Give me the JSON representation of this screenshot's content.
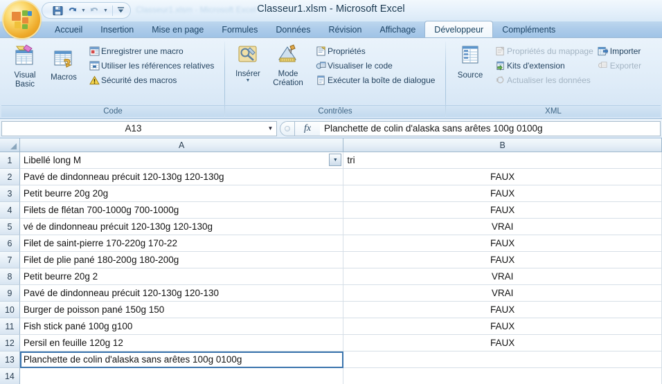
{
  "window": {
    "title": "Classeur1.xlsm - Microsoft Excel",
    "ghost_title": "Classeur1.xlsm - Microsoft Excel"
  },
  "quick_access": {
    "save_label": "save-icon",
    "undo_label": "undo-icon",
    "redo_label": "redo-icon",
    "customize_label": "customize-icon"
  },
  "tabs": [
    {
      "label": "Accueil",
      "active": false
    },
    {
      "label": "Insertion",
      "active": false
    },
    {
      "label": "Mise en page",
      "active": false
    },
    {
      "label": "Formules",
      "active": false
    },
    {
      "label": "Données",
      "active": false
    },
    {
      "label": "Révision",
      "active": false
    },
    {
      "label": "Affichage",
      "active": false
    },
    {
      "label": "Développeur",
      "active": true
    },
    {
      "label": "Compléments",
      "active": false
    }
  ],
  "ribbon": {
    "groups": [
      {
        "name": "Code",
        "label": "Code",
        "big_buttons": [
          {
            "label_line1": "Visual",
            "label_line2": "Basic",
            "icon": "visual-basic-icon"
          },
          {
            "label_line1": "Macros",
            "label_line2": "",
            "icon": "macros-icon"
          }
        ],
        "small_buttons": [
          {
            "label": "Enregistrer une macro",
            "icon": "record-macro-icon",
            "disabled": false
          },
          {
            "label": "Utiliser les références relatives",
            "icon": "relative-references-icon",
            "disabled": false
          },
          {
            "label": "Sécurité des macros",
            "icon": "warning-icon",
            "disabled": false
          }
        ]
      },
      {
        "name": "Controles",
        "label": "Contrôles",
        "big_buttons": [
          {
            "label_line1": "Insérer",
            "label_line2": "",
            "icon": "insert-control-icon",
            "has_caret": true
          },
          {
            "label_line1": "Mode",
            "label_line2": "Création",
            "icon": "design-mode-icon"
          }
        ],
        "small_buttons": [
          {
            "label": "Propriétés",
            "icon": "properties-icon",
            "disabled": false
          },
          {
            "label": "Visualiser le code",
            "icon": "view-code-icon",
            "disabled": false
          },
          {
            "label": "Exécuter la boîte de dialogue",
            "icon": "run-dialog-icon",
            "disabled": false
          }
        ]
      },
      {
        "name": "XML",
        "label": "XML",
        "big_buttons": [
          {
            "label_line1": "Source",
            "label_line2": "",
            "icon": "xml-source-icon"
          }
        ],
        "small_buttons": [
          {
            "label": "Propriétés du mappage",
            "icon": "map-properties-icon",
            "disabled": true
          },
          {
            "label": "Kits d'extension",
            "icon": "expansion-packs-icon",
            "disabled": false
          },
          {
            "label": "Actualiser les données",
            "icon": "refresh-data-icon",
            "disabled": true
          }
        ],
        "small_buttons_2": [
          {
            "label": "Importer",
            "icon": "import-icon",
            "disabled": false
          },
          {
            "label": "Exporter",
            "icon": "export-icon",
            "disabled": true
          }
        ]
      }
    ]
  },
  "formula_bar": {
    "name_box_value": "A13",
    "fx_label": "fx",
    "formula_value": "Planchette de colin d'alaska sans arêtes 100g 0100g"
  },
  "sheet": {
    "columns": [
      {
        "letter": "A"
      },
      {
        "letter": "B"
      }
    ],
    "rows": [
      {
        "num": "1",
        "a": "Libellé long M",
        "b": "tri",
        "has_filter": true,
        "b_align": "left"
      },
      {
        "num": "2",
        "a": "Pavé de dindonneau précuit 120-130g 120-130g",
        "b": "FAUX"
      },
      {
        "num": "3",
        "a": "Petit beurre 20g 20g",
        "b": "FAUX"
      },
      {
        "num": "4",
        "a": "Filets de flétan 700-1000g 700-1000g",
        "b": "FAUX"
      },
      {
        "num": "5",
        "a": "vé de dindonneau précuit 120-130g 120-130g",
        "b": "VRAI"
      },
      {
        "num": "6",
        "a": "Filet de saint-pierre 170-220g 170-22",
        "b": "FAUX"
      },
      {
        "num": "7",
        "a": "Filet de plie pané 180-200g 180-200g",
        "b": "FAUX"
      },
      {
        "num": "8",
        "a": "Petit beurre 20g 2",
        "b": "VRAI"
      },
      {
        "num": "9",
        "a": "Pavé de dindonneau précuit 120-130g 120-130",
        "b": "VRAI"
      },
      {
        "num": "10",
        "a": "Burger de poisson pané 150g 150",
        "b": "FAUX"
      },
      {
        "num": "11",
        "a": "Fish stick pané 100g g100",
        "b": "FAUX"
      },
      {
        "num": "12",
        "a": "Persil en feuille 120g 12",
        "b": "FAUX"
      },
      {
        "num": "13",
        "a": "Planchette de colin d'alaska sans arêtes 100g 0100g",
        "b": "",
        "selected": true
      },
      {
        "num": "14",
        "a": "",
        "b": ""
      }
    ]
  },
  "colors": {
    "accent": "#3a74ad",
    "ribbon_bg": "#dfecf8",
    "tab_active": "#f4f9fd",
    "grid_line": "#d6dfe7"
  }
}
